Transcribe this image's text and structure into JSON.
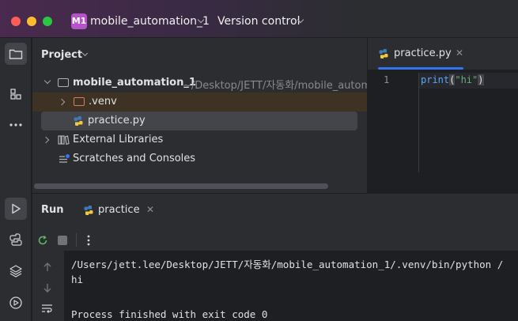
{
  "window": {
    "project_badge": "M1",
    "project_name": "mobile_automation_1",
    "version_control": "Version control"
  },
  "project_panel": {
    "title": "Project",
    "root": {
      "name": "mobile_automation_1",
      "path": "~/Desktop/JETT/자동화/mobile_automa"
    },
    "items": [
      {
        "name": ".venv"
      },
      {
        "name": "practice.py"
      },
      {
        "name": "External Libraries"
      },
      {
        "name": "Scratches and Consoles"
      }
    ]
  },
  "editor": {
    "tab_label": "practice.py",
    "line_number": "1",
    "code_fn": "print",
    "code_open": "(",
    "code_str": "\"hi\"",
    "code_close": ")"
  },
  "run_panel": {
    "title": "Run",
    "tab_label": "practice",
    "console_lines": [
      "/Users/jett.lee/Desktop/JETT/자동화/mobile_automation_1/.venv/bin/python /",
      "hi",
      "",
      "Process finished with exit code 0"
    ]
  },
  "colors": {
    "accent": "#3574f0",
    "badge": "#b554c9",
    "function": "#56a8f5",
    "string": "#6aab73"
  }
}
